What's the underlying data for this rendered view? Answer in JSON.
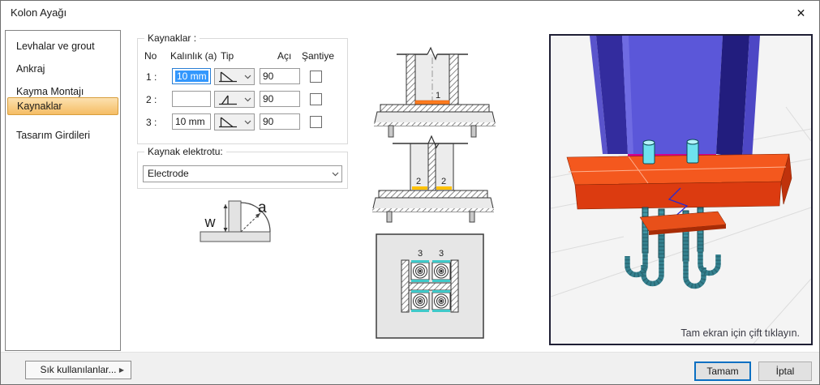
{
  "window": {
    "title": "Kolon Ayağı",
    "close_glyph": "✕"
  },
  "sidebar": {
    "items": [
      {
        "label": "Levhalar ve grout",
        "selected": false
      },
      {
        "label": "Ankraj",
        "selected": false
      },
      {
        "label": "Kayma Montajı",
        "selected": false
      },
      {
        "label": "Kaynaklar",
        "selected": true
      },
      {
        "label": "Tasarım Girdileri",
        "selected": false
      }
    ]
  },
  "welds": {
    "legend": "Kaynaklar :",
    "headers": {
      "no": "No",
      "thickness": "Kalınlık (a)",
      "type": "Tip",
      "angle": "Açı",
      "site": "Şantiye"
    },
    "rows": [
      {
        "no": "1 :",
        "thickness": "10 mm",
        "type_icon": "fillet-weld",
        "angle": "90",
        "site_checked": false,
        "focused": true
      },
      {
        "no": "2 :",
        "thickness": "",
        "type_icon": "bevel-weld",
        "angle": "90",
        "site_checked": false,
        "focused": false
      },
      {
        "no": "3 :",
        "thickness": "10 mm",
        "type_icon": "fillet-weld",
        "angle": "90",
        "site_checked": false,
        "focused": false
      }
    ]
  },
  "electrode": {
    "legend": "Kaynak elektrotu:",
    "value": "Electrode"
  },
  "weld_symbol": {
    "w_label": "w",
    "a_label": "a"
  },
  "diagrams": {
    "d1_label": "1",
    "d2_label_left": "2",
    "d2_label_right": "2",
    "d3_label_left": "3",
    "d3_label_right": "3"
  },
  "viewer": {
    "caption": "Tam ekran için çift tıklayın."
  },
  "footer": {
    "favorites": "Sık kullanılanlar...",
    "favorites_arrow": "▶",
    "ok": "Tamam",
    "cancel": "İptal"
  },
  "colors": {
    "selection_orange": "#f5bd64",
    "focus_blue": "#2a7fd4",
    "text_selection": "#3297fd",
    "weld1_orange": "#ff7b1e",
    "weld2_yellow": "#ffc103",
    "weld3_cyan": "#3fc9c9",
    "column_blue": "#5b57d9",
    "plate_orange": "#f4581e",
    "bolt_cyan": "#6ee2ef",
    "weld_magenta": "#d6008f"
  }
}
